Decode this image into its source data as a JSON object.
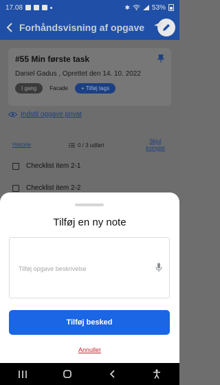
{
  "status_bar": {
    "time": "17.08",
    "battery": "53%"
  },
  "app_bar": {
    "title": "Forhåndsvisning af opgave"
  },
  "task": {
    "title": "#55 Min første task",
    "meta": "Daniel Gadus , Oprettet den  14. 10. 2022",
    "status_chip": "I gang",
    "phase_chip": "Facade",
    "add_tags": "Tilføj tags"
  },
  "privacy_link": "Indstil opgave privat",
  "checklist": {
    "history_link": "Historie",
    "progress": "0 / 3 udført",
    "hide_link_line1": "Skjul",
    "hide_link_line2": "komplet",
    "items": [
      "Checklist item 2-1",
      "Checklist item 2-2"
    ]
  },
  "sheet": {
    "title": "Tilføj en ny note",
    "placeholder": "Tilføj opgave beskrivelse",
    "submit_label": "Tilføj besked",
    "cancel_label": "Annuller"
  },
  "colors": {
    "primary": "#1a66e4",
    "app_bar": "#1f4fa6",
    "cancel": "#c0272d"
  },
  "icons": [
    "back-arrow-icon",
    "send-icon",
    "edit-icon",
    "pin-icon",
    "eye-icon",
    "checklist-icon",
    "mic-icon",
    "recents-icon",
    "home-icon",
    "back-icon",
    "accessibility-icon"
  ]
}
